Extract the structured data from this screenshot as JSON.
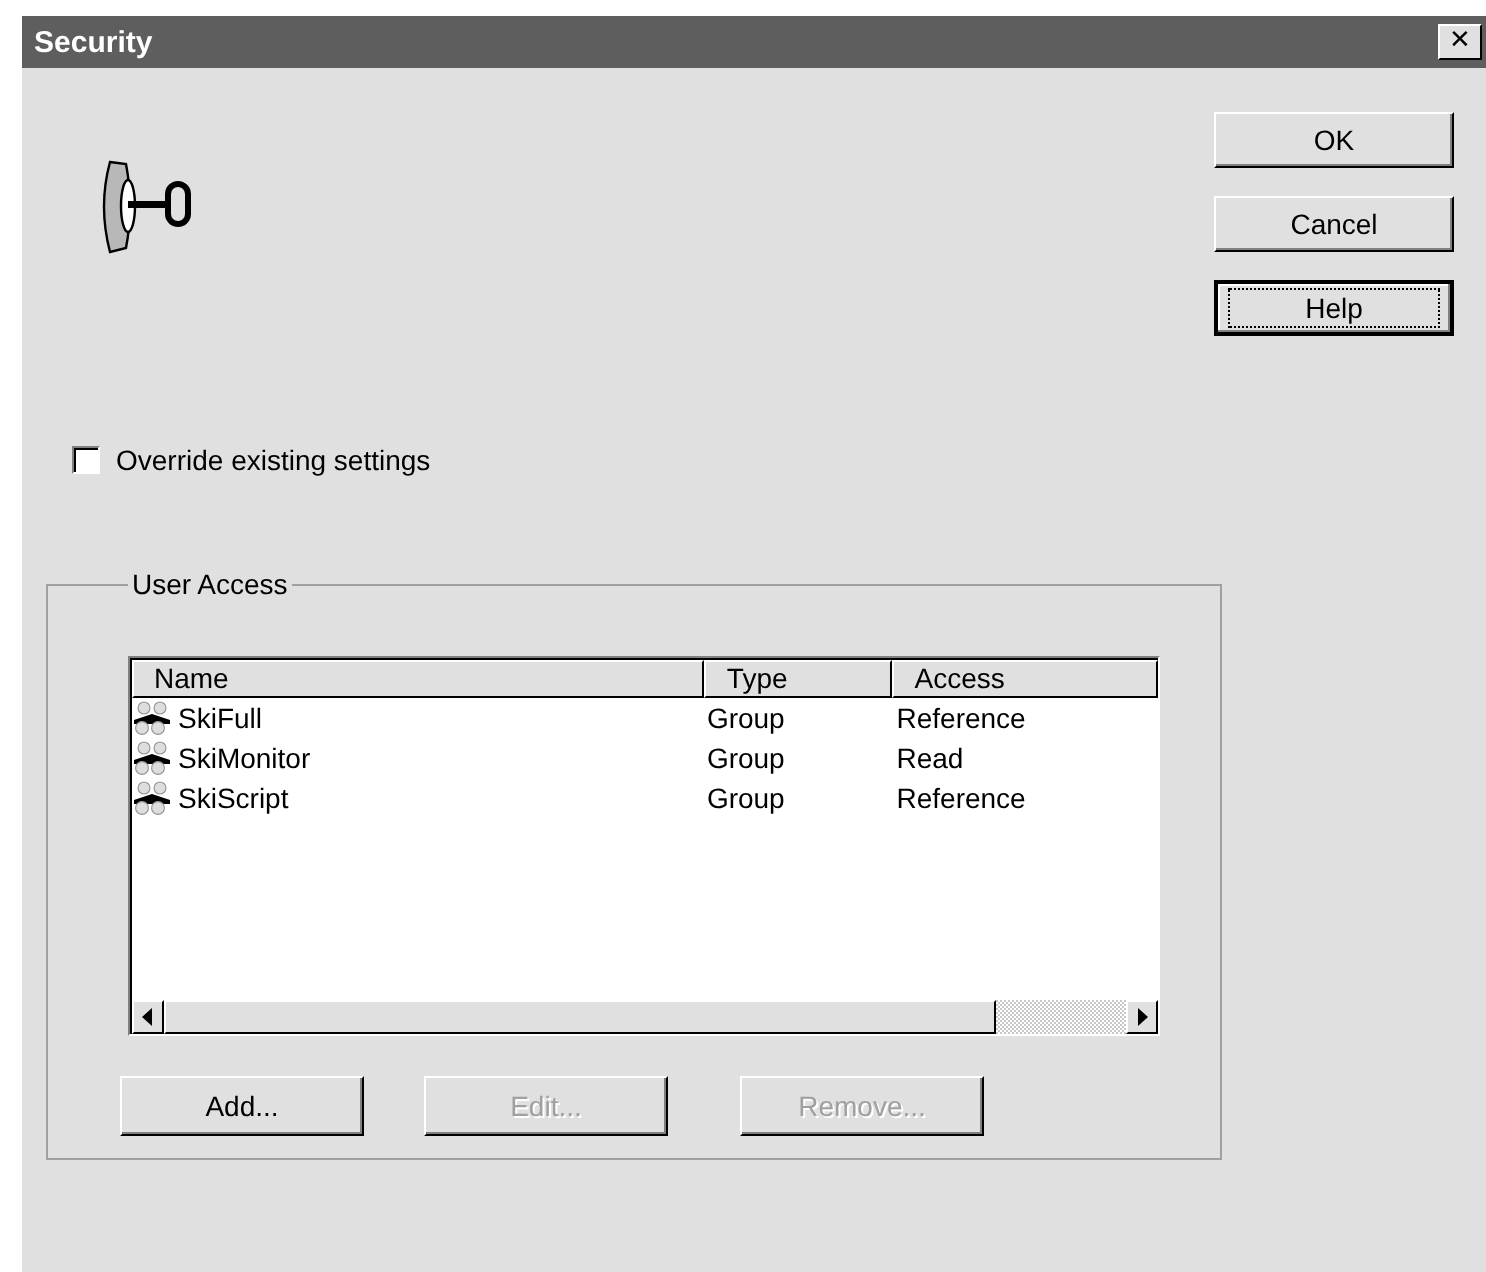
{
  "window": {
    "title": "Security",
    "close_glyph": "✕"
  },
  "dialog_buttons": [
    {
      "label": "OK",
      "focused": false
    },
    {
      "label": "Cancel",
      "focused": false
    },
    {
      "label": "Help",
      "focused": true
    }
  ],
  "override": {
    "label": "Override existing settings",
    "checked": false
  },
  "user_access": {
    "title": "User Access",
    "columns": [
      "Name",
      "Type",
      "Access"
    ],
    "rows": [
      {
        "name": "SkiFull",
        "type": "Group",
        "access": "Reference"
      },
      {
        "name": "SkiMonitor",
        "type": "Group",
        "access": "Read"
      },
      {
        "name": "SkiScript",
        "type": "Group",
        "access": "Reference"
      }
    ],
    "buttons": [
      {
        "label": "Add...",
        "disabled": false
      },
      {
        "label": "Edit...",
        "disabled": true
      },
      {
        "label": "Remove...",
        "disabled": true
      }
    ]
  }
}
